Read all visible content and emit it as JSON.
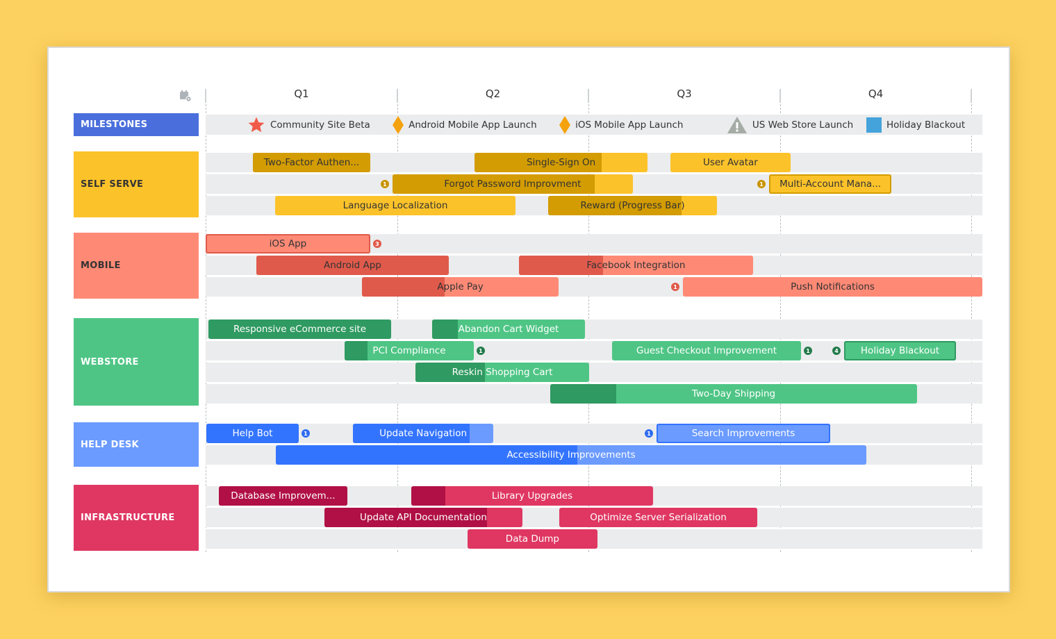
{
  "header": {
    "settings_icon": "calendar-gear-icon",
    "quarters": [
      "Q1",
      "Q2",
      "Q3",
      "Q4"
    ]
  },
  "milestones": {
    "label": "MILESTONES",
    "color": "#4a6fdc",
    "items": [
      {
        "label": "Community Site Beta",
        "icon": "star-icon",
        "color": "#f05a4a",
        "at": 0.265
      },
      {
        "label": "Android Mobile App Launch",
        "icon": "diamond-icon",
        "color": "#f5a20f",
        "at": 1.024
      },
      {
        "label": "iOS Mobile App Launch",
        "icon": "diamond-icon",
        "color": "#f5a20f",
        "at": 1.895
      },
      {
        "label": "US Web Store Launch",
        "icon": "warning-icon",
        "color": "#a5aba5",
        "at": 2.769
      },
      {
        "label": "Holiday Blackout",
        "icon": "square-icon",
        "color": "#45a3dc",
        "at": 3.499
      }
    ]
  },
  "groups": [
    {
      "label": "SELF SERVE",
      "label_color": "#fbc22a",
      "label_text": "#333333",
      "bar_color": "#fbc22a",
      "progress_color": "#d39c02",
      "text_color": "#333333",
      "badge_color": "#c99400",
      "rows": [
        [
          {
            "label": "Two-Factor Authen...",
            "start": 0.247,
            "end": 0.86,
            "progress": 1.0
          },
          {
            "label": "Single-Sign On",
            "start": 1.405,
            "end": 2.309,
            "progress": 0.735
          },
          {
            "label": "User Avatar",
            "start": 2.428,
            "end": 3.056,
            "progress": 0
          }
        ],
        [
          {
            "label": "Forgot Password Improvment",
            "start": 0.976,
            "end": 2.232,
            "progress": 0.84,
            "badge": "1"
          },
          {
            "label": "Multi-Account Mana...",
            "start": 2.944,
            "end": 3.583,
            "progress": 0,
            "badge": "1",
            "outlined": true
          }
        ],
        [
          {
            "label": "Language Localization",
            "start": 0.363,
            "end": 1.619,
            "progress": 0
          },
          {
            "label": "Reward (Progress Bar)",
            "start": 1.789,
            "end": 2.672,
            "progress": 0.79
          }
        ]
      ]
    },
    {
      "label": "MOBILE",
      "label_color": "#fe8a76",
      "label_text": "#333333",
      "bar_color": "#fe8a76",
      "progress_color": "#e05a4b",
      "text_color": "#333333",
      "badge_color": "#e05a4b",
      "rows": [
        [
          {
            "label": "iOS App",
            "start": 0.0,
            "end": 0.86,
            "progress": 0,
            "badge": "3",
            "outlined": true
          }
        ],
        [
          {
            "label": "Android App",
            "start": 0.265,
            "end": 1.27,
            "progress": 1.0
          },
          {
            "label": "Facebook Integration",
            "start": 1.637,
            "end": 2.86,
            "progress": 0.36
          }
        ],
        [
          {
            "label": "Apple Pay",
            "start": 0.817,
            "end": 1.844,
            "progress": 0.42
          },
          {
            "label": "Push Notifications",
            "start": 2.494,
            "end": 4.058,
            "progress": 0,
            "badge": "1"
          }
        ]
      ]
    },
    {
      "label": "WEBSTORE",
      "label_color": "#4fc585",
      "label_text": "#ffffff",
      "bar_color": "#4fc585",
      "progress_color": "#2f9a61",
      "text_color": "#ffffff",
      "badge_color": "#237a4b",
      "rows": [
        [
          {
            "label": "Responsive eCommerce site",
            "start": 0.015,
            "end": 0.969,
            "progress": 1.0
          },
          {
            "label": "Abandon Cart Widget",
            "start": 1.183,
            "end": 1.982,
            "progress": 0.17
          }
        ],
        [
          {
            "label": "PCI Compliance",
            "start": 0.726,
            "end": 1.401,
            "progress": 0.18,
            "badge": "1"
          },
          {
            "label": "Guest Checkout Improvement",
            "start": 2.123,
            "end": 3.111,
            "progress": 0,
            "badge": "1"
          },
          {
            "label": "Holiday Blackout",
            "start": 3.336,
            "end": 3.92,
            "progress": 0,
            "badge": "4",
            "outlined": true
          }
        ],
        [
          {
            "label": "Reskin Shopping Cart",
            "start": 1.096,
            "end": 2.004,
            "progress": 0.4
          }
        ],
        [
          {
            "label": "Two-Day Shipping",
            "start": 1.8,
            "end": 3.717,
            "progress": 0.18
          }
        ]
      ]
    },
    {
      "label": "HELP DESK",
      "label_color": "#6b9bff",
      "label_text": "#ffffff",
      "bar_color": "#6b9bff",
      "progress_color": "#3374ff",
      "text_color": "#ffffff",
      "badge_color": "#2f6cf0",
      "rows": [
        [
          {
            "label": "Help Bot",
            "start": 0.004,
            "end": 0.486,
            "progress": 1.0,
            "badge": "1"
          },
          {
            "label": "Update Navigation",
            "start": 0.77,
            "end": 1.503,
            "progress": 0.83
          },
          {
            "label": "Search Improvements",
            "start": 2.356,
            "end": 3.263,
            "progress": 0,
            "badge": "1",
            "badge_side": "left",
            "outlined": true
          }
        ],
        [
          {
            "label": "Accessibility Improvements",
            "start": 0.367,
            "end": 3.452,
            "progress": 0.51
          }
        ]
      ]
    },
    {
      "label": "INFRASTRUCTURE",
      "label_color": "#df3762",
      "label_text": "#ffffff",
      "bar_color": "#df3762",
      "progress_color": "#b01045",
      "text_color": "#ffffff",
      "badge_color": "#b01045",
      "rows": [
        [
          {
            "label": "Database Improvem...",
            "start": 0.069,
            "end": 0.74,
            "progress": 1.0
          },
          {
            "label": "Library Upgrades",
            "start": 1.074,
            "end": 2.338,
            "progress": 0.14
          }
        ],
        [
          {
            "label": "Update API Documentation",
            "start": 0.621,
            "end": 1.655,
            "progress": 0.82
          },
          {
            "label": "Optimize Server Serialization",
            "start": 1.848,
            "end": 2.882,
            "progress": 0
          }
        ],
        [
          {
            "label": "Data Dump",
            "start": 1.368,
            "end": 2.047,
            "progress": 0
          }
        ]
      ]
    }
  ]
}
